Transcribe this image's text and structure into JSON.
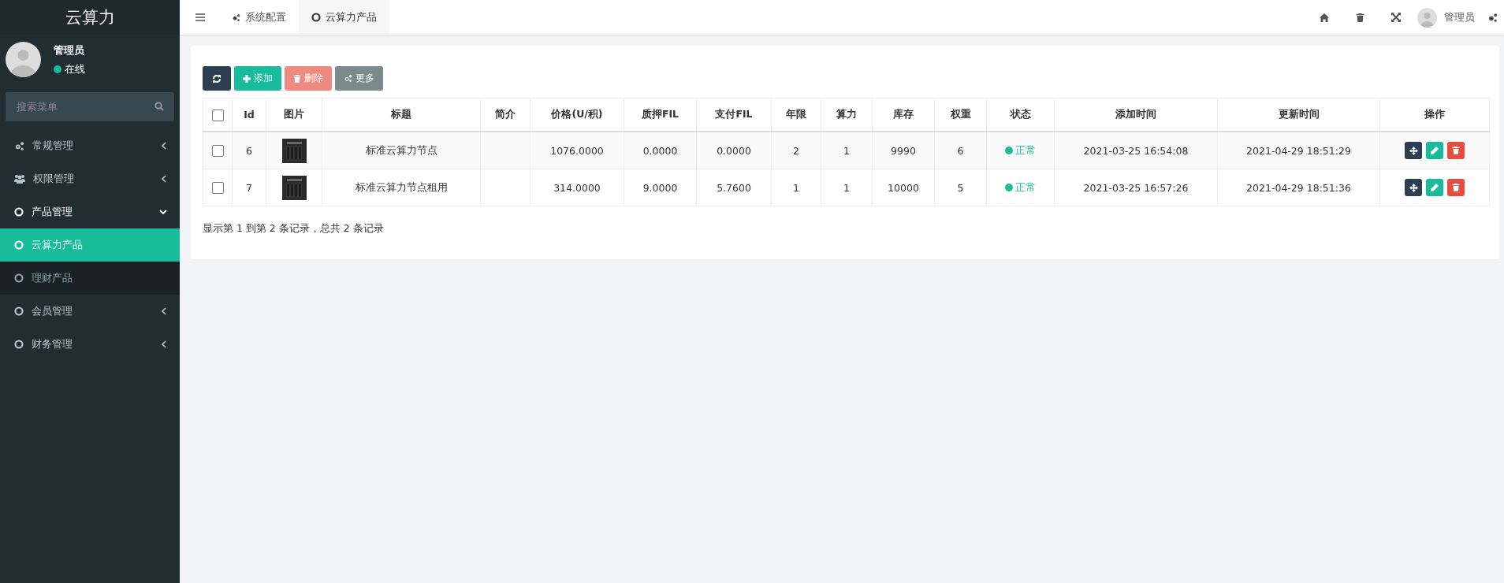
{
  "sidebar": {
    "logo": "云算力",
    "user": {
      "name": "管理员",
      "status": "在线"
    },
    "search": {
      "placeholder": "搜索菜单"
    },
    "menu": [
      {
        "label": "常规管理",
        "expanded": false,
        "selected": false
      },
      {
        "label": "权限管理",
        "expanded": false,
        "selected": false
      },
      {
        "label": "产品管理",
        "expanded": true,
        "selected": false,
        "children": [
          {
            "label": "云算力产品",
            "selected": true
          },
          {
            "label": "理财产品",
            "selected": false
          }
        ]
      },
      {
        "label": "会员管理",
        "expanded": false,
        "selected": false
      },
      {
        "label": "财务管理",
        "expanded": false,
        "selected": false
      }
    ]
  },
  "topbar": {
    "tabs": [
      {
        "label": "系统配置",
        "selected": false
      },
      {
        "label": "云算力产品",
        "selected": true
      }
    ],
    "user": "管理员"
  },
  "toolbar": [
    {
      "kind": "refresh",
      "disabled": false
    },
    {
      "kind": "add",
      "label": "添加",
      "disabled": false
    },
    {
      "kind": "delete",
      "label": "删除",
      "disabled": true
    },
    {
      "kind": "more",
      "label": "更多",
      "disabled": false
    }
  ],
  "table": {
    "all_checked": false,
    "columns": [
      "Id",
      "图片",
      "标题",
      "简介",
      "价格(U/积)",
      "质押FIL",
      "支付FIL",
      "年限",
      "算力",
      "库存",
      "权重",
      "状态",
      "添加时间",
      "更新时间",
      "操作"
    ],
    "rows": [
      {
        "checked": false,
        "id": "6",
        "title": "标准云算力节点",
        "price": "1076.0000",
        "pledge": "0.0000",
        "pay": "0.0000",
        "years": "2",
        "power": "1",
        "stock": "9990",
        "weight": "6",
        "status": "正常",
        "added": "2021-03-25 16:54:08",
        "updated": "2021-04-29 18:51:29"
      },
      {
        "checked": false,
        "id": "7",
        "title": "标准云算力节点租用",
        "price": "314.0000",
        "pledge": "9.0000",
        "pay": "5.7600",
        "years": "1",
        "power": "1",
        "stock": "10000",
        "weight": "5",
        "status": "正常",
        "added": "2021-03-25 16:57:26",
        "updated": "2021-04-29 18:51:36"
      }
    ]
  },
  "footer": "显示第 1 到第 2 条记录，总共 2 条记录"
}
